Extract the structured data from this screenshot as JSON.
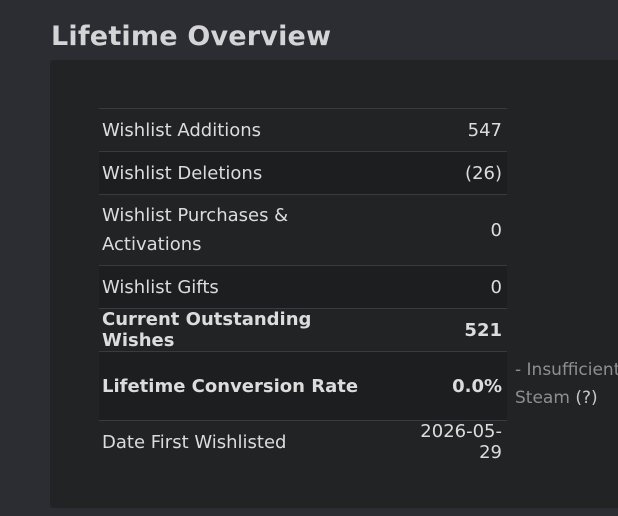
{
  "page": {
    "title": "Lifetime Overview"
  },
  "stats": {
    "rows": [
      {
        "label": "Wishlist Additions",
        "value": "547"
      },
      {
        "label": "Wishlist Deletions",
        "value": "(26)"
      },
      {
        "label": "Wishlist Purchases & Activations",
        "value": "0"
      },
      {
        "label": "Wishlist Gifts",
        "value": "0"
      },
      {
        "label": "Current Outstanding Wishes",
        "value": "521"
      },
      {
        "label": "Lifetime Conversion Rate",
        "value": "0.0%"
      },
      {
        "label": "Date First Wishlisted",
        "value": "2026-05-29"
      }
    ],
    "conversion_note": {
      "text_line1": "- Insufficient",
      "text_line2": "Steam",
      "help_link": "(?)"
    }
  }
}
